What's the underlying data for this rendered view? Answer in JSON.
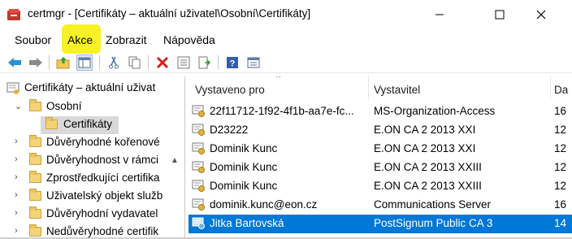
{
  "window": {
    "title": "certmgr - [Certifikáty – aktuální uživatel\\Osobní\\Certifikáty]",
    "min_glyph": "—",
    "max_glyph": "☐",
    "close_glyph": "✕"
  },
  "menu": [
    "Soubor",
    "Akce",
    "Zobrazit",
    "Nápověda"
  ],
  "highlight_color": "#f5f000",
  "toolbar_icons": [
    "back-arrow-icon",
    "forward-arrow-icon",
    "up-folder-icon",
    "show-hide-tree-icon",
    "cut-icon",
    "copy-icon",
    "delete-icon",
    "properties-icon",
    "export-list-icon",
    "help-icon",
    "view-icon"
  ],
  "tree": {
    "root": "Certifikáty – aktuální uživat",
    "items": [
      {
        "label": "Osobní",
        "chevron": "⌄"
      },
      {
        "label": "Certifikáty",
        "chevron": ""
      },
      {
        "label": "Důvěryhodné kořenové",
        "chevron": "›"
      },
      {
        "label": "Důvěryhodnost v rámci",
        "chevron": "›"
      },
      {
        "label": "Zprostředkující certifika",
        "chevron": "›"
      },
      {
        "label": "Uživatelský objekt služb",
        "chevron": "›"
      },
      {
        "label": "Důvěryhodní vydavatel",
        "chevron": "›"
      },
      {
        "label": "Nedůvěryhodné certifik",
        "chevron": "›"
      }
    ],
    "scroll_up": "▲"
  },
  "list": {
    "columns": [
      "Vystaveno pro",
      "Vystavitel",
      "Da"
    ],
    "sort_glyph": "^",
    "rows": [
      {
        "issued_to": "22f11712-1f92-4f1b-aa7e-fc...",
        "issuer": "MS-Organization-Access",
        "date": "16"
      },
      {
        "issued_to": "D23222",
        "issuer": "E.ON CA 2 2013 XXI",
        "date": "12"
      },
      {
        "issued_to": "Dominik Kunc",
        "issuer": "E.ON CA 2 2013 XXI",
        "date": "12"
      },
      {
        "issued_to": "Dominik Kunc",
        "issuer": "E.ON CA 2 2013 XXIII",
        "date": "12"
      },
      {
        "issued_to": "Dominik Kunc",
        "issuer": "E.ON CA 2 2013 XXIII",
        "date": "12"
      },
      {
        "issued_to": "dominik.kunc@eon.cz",
        "issuer": "Communications Server",
        "date": "16"
      },
      {
        "issued_to": "Jitka Bartovská",
        "issuer": "PostSignum Public CA 3",
        "date": "14"
      }
    ],
    "selected_color": "#0078d7"
  }
}
